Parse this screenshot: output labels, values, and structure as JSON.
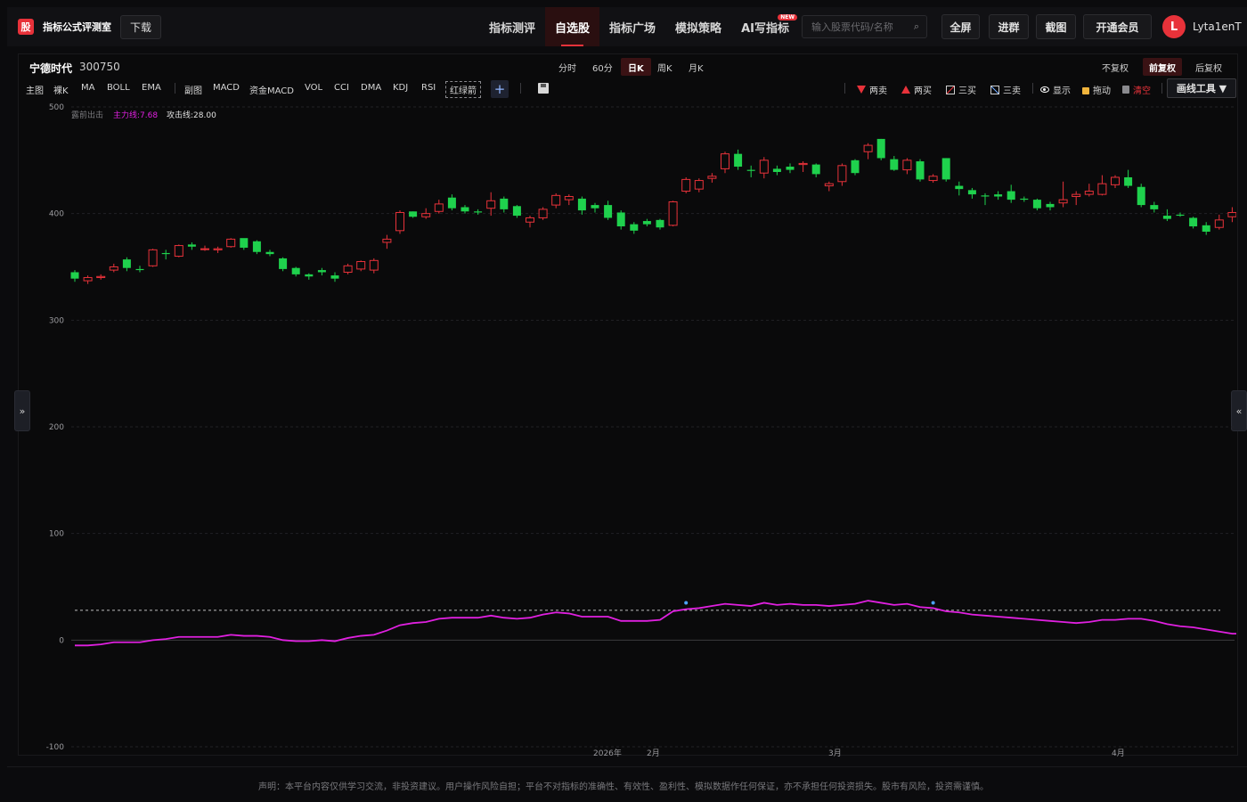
{
  "app": {
    "logo_char": "股",
    "logo_text": "指标公式评测室",
    "download": "下载"
  },
  "nav": [
    {
      "label": "指标测评",
      "active": false
    },
    {
      "label": "自选股",
      "active": true
    },
    {
      "label": "指标广场",
      "active": false
    },
    {
      "label": "模拟策略",
      "active": false
    },
    {
      "label": "AI写指标",
      "active": false,
      "badge": "NEW"
    }
  ],
  "search": {
    "placeholder": "输入股票代码/名称"
  },
  "top_buttons": {
    "fullscreen": "全屏",
    "group": "进群",
    "screenshot": "截图",
    "vip": "开通会员"
  },
  "user": {
    "initial": "L",
    "name": "Lyta1enT"
  },
  "stock": {
    "name": "宁德时代",
    "code": "300750"
  },
  "periods": [
    {
      "label": "分时",
      "active": false
    },
    {
      "label": "60分",
      "active": false
    },
    {
      "label": "日K",
      "active": true
    },
    {
      "label": "周K",
      "active": false
    },
    {
      "label": "月K",
      "active": false
    }
  ],
  "adjust": [
    {
      "label": "不复权",
      "active": false
    },
    {
      "label": "前复权",
      "active": true
    },
    {
      "label": "后复权",
      "active": false
    }
  ],
  "indicators": {
    "main": "主图",
    "naked_k": "裸K",
    "ma": "MA",
    "boll": "BOLL",
    "ema": "EMA",
    "sub": "副图",
    "macd": "MACD",
    "fund_macd": "资金MACD",
    "vol": "VOL",
    "cci": "CCI",
    "dma": "DMA",
    "kdj": "KDJ",
    "rsi": "RSI",
    "custom": "红绿箭"
  },
  "plus_label": "+",
  "tools": {
    "two_sell": "两卖",
    "two_buy": "两买",
    "three_buy": "三买",
    "three_sell": "三卖",
    "show": "显示",
    "drag": "拖动",
    "clear": "清空",
    "draw_tools": "画线工具 ▼"
  },
  "legend": {
    "escape": "露前出击",
    "main_line": "主力线:7.68",
    "attack_line": "攻击线:28.00"
  },
  "colors": {
    "up": "#e8323a",
    "down": "#1fd14d",
    "main_line": "#e020e0",
    "accent": "#e8323a"
  },
  "chart_data": {
    "type": "candlestick",
    "y_axis_ticks": [
      500,
      400,
      300,
      200,
      100,
      0,
      -100
    ],
    "ylim": [
      -100,
      500
    ],
    "x_tick_labels": [
      "2026年",
      "2月",
      "3月",
      "4月"
    ],
    "ohlc": [
      [
        345,
        347,
        336,
        339
      ],
      [
        337,
        342,
        334,
        340
      ],
      [
        340,
        343,
        338,
        341
      ],
      [
        347,
        353,
        345,
        350
      ],
      [
        357,
        359,
        346,
        349
      ],
      [
        348,
        351,
        345,
        347
      ],
      [
        351,
        367,
        350,
        366
      ],
      [
        363,
        366,
        357,
        362
      ],
      [
        360,
        371,
        359,
        370
      ],
      [
        371,
        373,
        366,
        369
      ],
      [
        367,
        370,
        365,
        367
      ],
      [
        366,
        369,
        363,
        367
      ],
      [
        369,
        377,
        368,
        376
      ],
      [
        377,
        376,
        366,
        368
      ],
      [
        374,
        375,
        362,
        364
      ],
      [
        364,
        366,
        360,
        362
      ],
      [
        358,
        359,
        346,
        348
      ],
      [
        349,
        350,
        341,
        343
      ],
      [
        343,
        344,
        338,
        341
      ],
      [
        347,
        349,
        342,
        345
      ],
      [
        342,
        345,
        336,
        339
      ],
      [
        345,
        353,
        343,
        351
      ],
      [
        348,
        356,
        346,
        355
      ],
      [
        347,
        358,
        344,
        356
      ],
      [
        373,
        380,
        367,
        376
      ],
      [
        384,
        403,
        381,
        401
      ],
      [
        402,
        402,
        396,
        397
      ],
      [
        397,
        405,
        395,
        400
      ],
      [
        402,
        413,
        400,
        409
      ],
      [
        415,
        418,
        403,
        405
      ],
      [
        406,
        408,
        400,
        402
      ],
      [
        402,
        404,
        399,
        401
      ],
      [
        405,
        420,
        398,
        412
      ],
      [
        414,
        416,
        401,
        404
      ],
      [
        407,
        408,
        396,
        398
      ],
      [
        392,
        398,
        387,
        396
      ],
      [
        396,
        406,
        394,
        404
      ],
      [
        408,
        419,
        405,
        417
      ],
      [
        413,
        418,
        408,
        416
      ],
      [
        414,
        416,
        399,
        403
      ],
      [
        408,
        410,
        401,
        405
      ],
      [
        408,
        412,
        394,
        396
      ],
      [
        401,
        403,
        385,
        388
      ],
      [
        390,
        392,
        381,
        384
      ],
      [
        393,
        395,
        388,
        390
      ],
      [
        394,
        395,
        385,
        387
      ],
      [
        389,
        412,
        388,
        411
      ],
      [
        421,
        434,
        419,
        432
      ],
      [
        423,
        433,
        420,
        431
      ],
      [
        433,
        438,
        429,
        435
      ],
      [
        442,
        458,
        438,
        456
      ],
      [
        456,
        460,
        441,
        444
      ],
      [
        441,
        445,
        434,
        440
      ],
      [
        438,
        453,
        433,
        450
      ],
      [
        442,
        445,
        436,
        439
      ],
      [
        444,
        447,
        438,
        441
      ],
      [
        446,
        449,
        439,
        447
      ],
      [
        446,
        447,
        434,
        437
      ],
      [
        426,
        430,
        421,
        428
      ],
      [
        430,
        447,
        426,
        445
      ],
      [
        450,
        451,
        436,
        438
      ],
      [
        458,
        466,
        451,
        464
      ],
      [
        470,
        470,
        450,
        452
      ],
      [
        451,
        454,
        440,
        441
      ],
      [
        441,
        452,
        437,
        450
      ],
      [
        449,
        451,
        430,
        432
      ],
      [
        431,
        437,
        429,
        435
      ],
      [
        452,
        452,
        430,
        432
      ],
      [
        426,
        430,
        417,
        423
      ],
      [
        422,
        424,
        414,
        418
      ],
      [
        417,
        419,
        408,
        416
      ],
      [
        418,
        421,
        413,
        416
      ],
      [
        421,
        427,
        410,
        413
      ],
      [
        414,
        416,
        411,
        413
      ],
      [
        413,
        414,
        403,
        405
      ],
      [
        409,
        411,
        403,
        406
      ],
      [
        410,
        430,
        406,
        413
      ],
      [
        416,
        421,
        408,
        418
      ],
      [
        418,
        428,
        416,
        421
      ],
      [
        418,
        436,
        417,
        428
      ],
      [
        427,
        436,
        424,
        434
      ],
      [
        434,
        441,
        424,
        426
      ],
      [
        425,
        428,
        406,
        408
      ],
      [
        408,
        411,
        401,
        404
      ],
      [
        398,
        404,
        393,
        395
      ],
      [
        399,
        401,
        397,
        398
      ],
      [
        396,
        397,
        386,
        388
      ],
      [
        389,
        392,
        380,
        383
      ],
      [
        387,
        399,
        385,
        394
      ],
      [
        397,
        406,
        392,
        401
      ]
    ],
    "indicator": {
      "main_line_values": [
        -5,
        -5,
        -4,
        -2,
        -2,
        -2,
        0,
        1,
        3,
        3,
        3,
        3,
        5,
        4,
        4,
        3,
        0,
        -1,
        -1,
        0,
        -1,
        2,
        4,
        5,
        9,
        14,
        16,
        17,
        20,
        21,
        21,
        21,
        23,
        21,
        20,
        21,
        24,
        26,
        25,
        22,
        22,
        22,
        18,
        18,
        18,
        19,
        27,
        29,
        30,
        32,
        34,
        33,
        32,
        35,
        33,
        34,
        33,
        33,
        32,
        33,
        34,
        37,
        35,
        33,
        34,
        31,
        30,
        27,
        26,
        24,
        23,
        22,
        21,
        20,
        19,
        18,
        17,
        16,
        17,
        19,
        19,
        20,
        20,
        18,
        15,
        13,
        12,
        10,
        8,
        6,
        6
      ],
      "attack_line_value": 28.0,
      "markers_at": [
        47,
        66
      ]
    }
  },
  "disclaimer": "声明：本平台内容仅供学习交流，非投资建议。用户操作风险自担；平台不对指标的准确性、有效性、盈利性、模拟数据作任何保证，亦不承担任何投资损失。股市有风险，投资需谨慎。"
}
